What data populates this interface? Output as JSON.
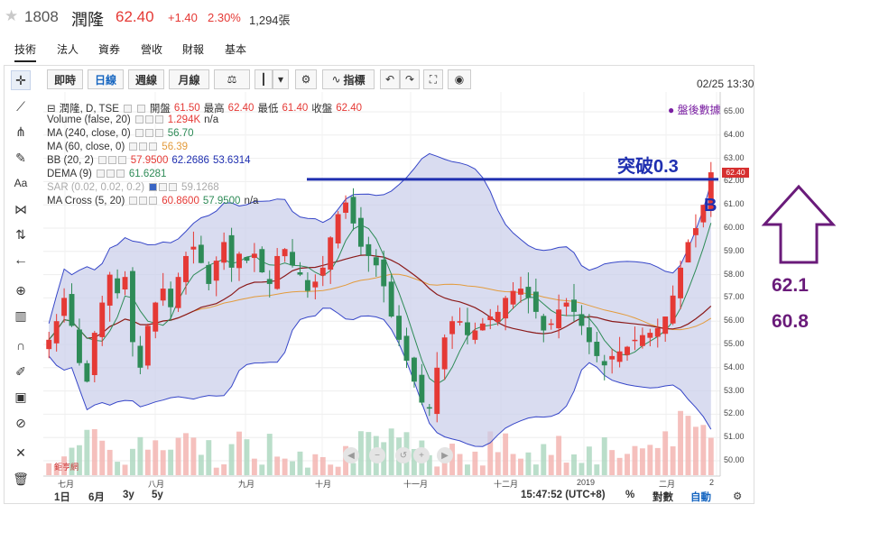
{
  "header": {
    "code": "1808",
    "name": "潤隆",
    "price": "62.40",
    "change": "+1.40",
    "percent": "2.30%",
    "volume": "1,294張"
  },
  "tabs": [
    {
      "label": "技術",
      "active": true
    },
    {
      "label": "法人"
    },
    {
      "label": "資券"
    },
    {
      "label": "營收"
    },
    {
      "label": "財報"
    },
    {
      "label": "基本"
    }
  ],
  "datetime": "02/25 13:30",
  "toolbar": {
    "intraday": "即時",
    "daily": "日線",
    "weekly": "週線",
    "monthly": "月線",
    "indicators": "指標"
  },
  "legend": {
    "main": {
      "label": "潤隆, D, TSE",
      "open_label": "開盤",
      "open": "61.50",
      "high_label": "最高",
      "high": "62.40",
      "low_label": "最低",
      "low": "61.40",
      "close_label": "收盤",
      "close": "62.40"
    },
    "volume": {
      "label": "Volume (false, 20)",
      "value": "1.294K",
      "extra": "n/a"
    },
    "ma240": {
      "label": "MA (240, close, 0)",
      "value": "56.70"
    },
    "ma60": {
      "label": "MA (60, close, 0)",
      "value": "56.39"
    },
    "bb": {
      "label": "BB (20, 2)",
      "v1": "57.9500",
      "v2": "62.2686",
      "v3": "53.6314"
    },
    "dema": {
      "label": "DEMA (9)",
      "value": "61.6281"
    },
    "sar": {
      "label": "SAR (0.02, 0.02, 0.2)",
      "value": "59.1268"
    },
    "macross": {
      "label": "MA Cross (5, 20)",
      "v1": "60.8600",
      "v2": "57.9500",
      "extra": "n/a"
    }
  },
  "after_hours": "● 盤後數據",
  "annotations": {
    "breakout": "突破0.3",
    "buy_mark": "B",
    "value_1": "62.1",
    "value_2": "60.8"
  },
  "yaxis": {
    "ticks": [
      "65.00",
      "64.00",
      "63.00",
      "62.00",
      "61.00",
      "60.00",
      "59.00",
      "58.00",
      "57.00",
      "56.00",
      "55.00",
      "54.00",
      "53.00",
      "52.00",
      "51.00",
      "50.00"
    ],
    "price_tag": "62.40"
  },
  "xaxis": {
    "ticks": [
      "七月",
      "八月",
      "九月",
      "十月",
      "十一月",
      "十二月",
      "2019",
      "二月",
      "2"
    ]
  },
  "bottom_bar": {
    "periods": [
      "1日",
      "6月",
      "3y",
      "5y"
    ],
    "clock": "15:47:52 (UTC+8)",
    "percent": "%",
    "log": "對數",
    "auto": "自動",
    "gear": "⚙"
  },
  "watermark": "鉅亨網",
  "colors": {
    "up": "#e53935",
    "down": "#2e8b57",
    "band": "#c9cdea",
    "band_line": "#3646c8",
    "breakout_line": "#1f2fb0",
    "annot": "#6a1b7a"
  },
  "chart_data": {
    "type": "candlestick",
    "yrange": [
      50,
      65.6
    ],
    "line_level": 62.1,
    "close": [
      55.2,
      56.0,
      57.0,
      55.8,
      54.2,
      53.4,
      55.5,
      56.8,
      58.0,
      57.2,
      57.9,
      55.1,
      54.0,
      55.8,
      56.8,
      57.4,
      56.6,
      57.9,
      58.8,
      59.2,
      58.5,
      57.6,
      58.6,
      59.4,
      58.3,
      58.9,
      58.6,
      58.9,
      58.1,
      57.6,
      58.8,
      59.1,
      58.4,
      58.0,
      57.3,
      57.7,
      58.3,
      59.6,
      60.6,
      61.1,
      60.2,
      59.2,
      58.8,
      58.4,
      57.5,
      56.2,
      55.2,
      54.3,
      53.4,
      52.5,
      52.3,
      54.0,
      55.3,
      56.0,
      56.0,
      55.4,
      55.6,
      55.9,
      56.2,
      56.4,
      57.0,
      57.3,
      57.4,
      57.0,
      56.4,
      55.6,
      55.9,
      56.5,
      56.8,
      56.4,
      55.8,
      55.1,
      54.5,
      54.1,
      54.5,
      54.7,
      54.9,
      55.2,
      55.4,
      55.5,
      55.7,
      56.2,
      57.1,
      58.3,
      59.4,
      60.0,
      61.0,
      62.4
    ]
  },
  "icons": [
    "crosshair-icon",
    "trend-line-icon",
    "fork-icon",
    "brush-icon",
    "text-icon",
    "pattern-icon",
    "measure-icon",
    "arrow-left-icon",
    "zoom-in-icon",
    "ruler-icon",
    "magnet-icon",
    "pencil-icon",
    "lock-icon",
    "eye-hidden-icon",
    "remove-tools-icon",
    "trash-icon"
  ]
}
